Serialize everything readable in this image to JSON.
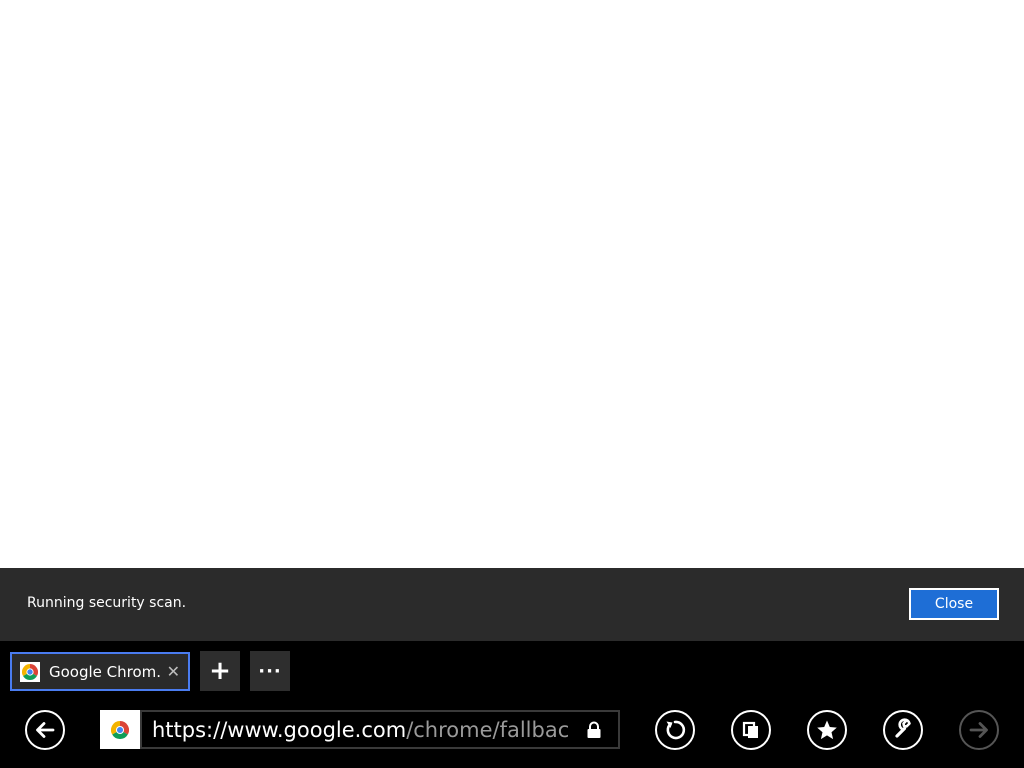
{
  "notification": {
    "message": "Running security scan.",
    "close_label": "Close"
  },
  "tab": {
    "title": "Google Chrom...",
    "close_glyph": "✕",
    "favicon": "chrome-icon"
  },
  "toolbar": {
    "new_tab_glyph": "+",
    "more_glyph": "···"
  },
  "address_bar": {
    "url_host": "https://www.google.com",
    "url_path": "/chrome/fallback/?br",
    "favicon": "chrome-icon",
    "secure_icon": "lock-icon"
  },
  "nav_buttons": [
    "back-icon",
    "refresh-icon",
    "tab-switch-icon",
    "favorites-icon",
    "settings-icon",
    "forward-icon"
  ],
  "colors": {
    "accent": "#1e6ed6",
    "tab_border": "#4a7cf0",
    "notification_bg": "#2b2b2b",
    "appbar_bg": "#000000"
  }
}
